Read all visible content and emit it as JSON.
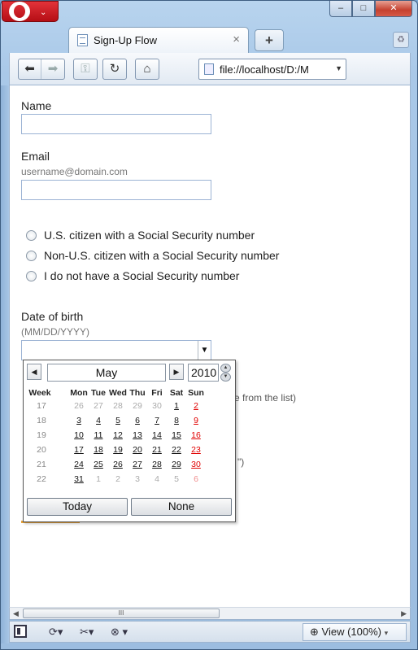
{
  "browser": {
    "tab_title": "Sign-Up Flow",
    "tab_close": "×",
    "new_tab": "+",
    "address": "file://localhost/D:/M",
    "address_dropdown": "▼",
    "win_min": "–",
    "win_max": "□",
    "win_close": "✕",
    "scroll_thumb_grip": "III",
    "status_view": "View (100%)"
  },
  "form": {
    "name_label": "Name",
    "email_label": "Email",
    "email_hint": "username@domain.com",
    "radio_options": [
      "U.S. citizen with a Social Security number",
      "Non-U.S. citizen with a Social Security number",
      "I do not have a Social Security number"
    ],
    "dob_label": "Date of birth",
    "dob_hint": "(MM/DD/YYYY)",
    "bg_text_1": "e from the list)",
    "bg_text_2": "\")"
  },
  "calendar": {
    "month": "May",
    "year": "2010",
    "headers": [
      "Week",
      "Mon",
      "Tue",
      "Wed",
      "Thu",
      "Fri",
      "Sat",
      "Sun"
    ],
    "weeks": [
      {
        "wk": "17",
        "days": [
          "26",
          "27",
          "28",
          "29",
          "30",
          "1",
          "2"
        ]
      },
      {
        "wk": "18",
        "days": [
          "3",
          "4",
          "5",
          "6",
          "7",
          "8",
          "9"
        ]
      },
      {
        "wk": "19",
        "days": [
          "10",
          "11",
          "12",
          "13",
          "14",
          "15",
          "16"
        ]
      },
      {
        "wk": "20",
        "days": [
          "17",
          "18",
          "19",
          "20",
          "21",
          "22",
          "23"
        ]
      },
      {
        "wk": "21",
        "days": [
          "24",
          "25",
          "26",
          "27",
          "28",
          "29",
          "30"
        ]
      },
      {
        "wk": "22",
        "days": [
          "31",
          "1",
          "2",
          "3",
          "4",
          "5",
          "6"
        ]
      }
    ],
    "today_label": "Today",
    "none_label": "None"
  },
  "colors": {
    "sunday": "#e00000",
    "accent_orange": "#e8a33a",
    "opera_red": "#c8161d"
  },
  "icons": [
    "back-icon",
    "forward-icon",
    "key-icon",
    "reload-icon",
    "home-icon",
    "page-icon",
    "panel-toggle-icon",
    "sync-icon",
    "tools-icon",
    "status-icon",
    "zoom-icon",
    "trash-icon"
  ]
}
